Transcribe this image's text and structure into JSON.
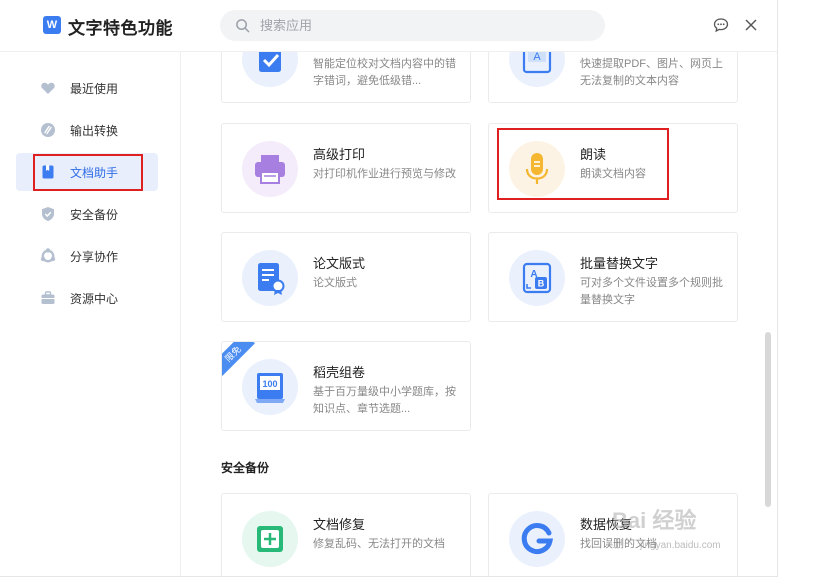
{
  "app": {
    "title": "文字特色功能",
    "logo_letter": "W"
  },
  "search": {
    "placeholder": "搜索应用"
  },
  "sidebar": {
    "items": [
      {
        "label": "最近使用",
        "icon": "heart-icon"
      },
      {
        "label": "输出转换",
        "icon": "convert-icon"
      },
      {
        "label": "文档助手",
        "icon": "document-helper-icon",
        "active": true
      },
      {
        "label": "安全备份",
        "icon": "shield-icon"
      },
      {
        "label": "分享协作",
        "icon": "share-icon"
      },
      {
        "label": "资源中心",
        "icon": "briefcase-icon"
      }
    ]
  },
  "cards": {
    "check": {
      "title": "",
      "desc": "智能定位校对文档内容中的错字错词，避免低级错...",
      "icon": "proofread-icon"
    },
    "extract": {
      "title": "",
      "desc": "快速提取PDF、图片、网页上无法复制的文本内容",
      "icon": "text-extract-icon"
    },
    "print": {
      "title": "高级打印",
      "desc": "对打印机作业进行预览与修改",
      "icon": "printer-icon"
    },
    "read": {
      "title": "朗读",
      "desc": "朗读文档内容",
      "icon": "microphone-icon"
    },
    "paper": {
      "title": "论文版式",
      "desc": "论文版式",
      "icon": "thesis-icon"
    },
    "replace": {
      "title": "批量替换文字",
      "desc": "可对多个文件设置多个规则批量替换文字",
      "icon": "replace-text-icon"
    },
    "exam": {
      "title": "稻壳组卷",
      "desc": "基于百万量级中小学题库，按知识点、章节选题...",
      "icon": "exam-paper-icon",
      "badge": "限免"
    },
    "repair": {
      "title": "文档修复",
      "desc": "修复乱码、无法打开的文档",
      "icon": "repair-icon"
    },
    "recover": {
      "title": "数据恢复",
      "desc": "找回误删的文档",
      "icon": "data-recovery-icon"
    }
  },
  "sections": {
    "backup": "安全备份"
  },
  "watermark": {
    "main": "Bai 经验",
    "sub": "jingyan.baidu.com"
  },
  "colors": {
    "accent": "#2f6ee6",
    "highlight_box": "#e02020"
  }
}
